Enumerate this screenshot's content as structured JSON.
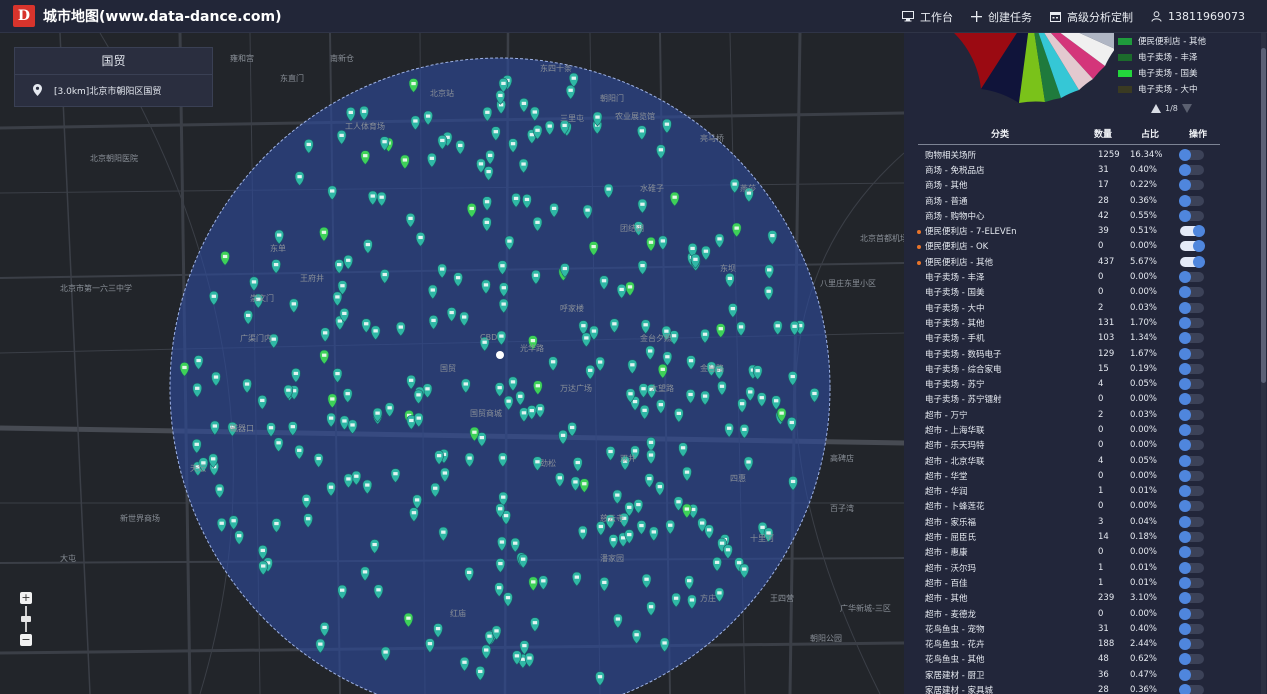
{
  "app": {
    "logo": "D",
    "title": "城市地图(www.data-dance.com)"
  },
  "header": {
    "actions": [
      {
        "icon": "desktop-icon",
        "label": "工作台"
      },
      {
        "icon": "plus-icon",
        "label": "创建任务"
      },
      {
        "icon": "calendar-icon",
        "label": "高级分析定制"
      },
      {
        "icon": "user-icon",
        "label": "13811969073"
      }
    ]
  },
  "district_panel": {
    "title": "国贸",
    "item": "[3.0km]北京市朝阳区国贸"
  },
  "map": {
    "labels": [
      "北京站",
      "朝阳门",
      "东四十条",
      "南新仓",
      "工人体育场",
      "三里屯",
      "农业展览馆",
      "亮马桥",
      "燕莎",
      "团结湖",
      "呼家楼",
      "金台夕照",
      "国贸",
      "大望路",
      "双井",
      "劲松",
      "潘家园",
      "广渠门内",
      "磁器口",
      "天坛",
      "崇文门",
      "东单",
      "王府井",
      "北京市第一六三中学",
      "东直门",
      "雍和宫",
      "和平里",
      "安贞",
      "北京朝阳医院",
      "国贸商城",
      "CBD",
      "光华路",
      "万达广场",
      "百子湾",
      "四惠",
      "高碑店",
      "十里河",
      "方庄",
      "朝阳公园",
      "八里庄东里小区",
      "广华新城-三区",
      "新世界商场",
      "北京首都机场",
      "大屯",
      "慈云寺",
      "东坝",
      "王四营",
      "红庙",
      "金台路",
      "水碓子"
    ]
  },
  "sidebar": {
    "legend": [
      {
        "label": "便民便利店 - 其他",
        "color": "#1f9b3c"
      },
      {
        "label": "电子卖场 - 丰泽",
        "color": "#1c6b2c"
      },
      {
        "label": "电子卖场 - 国美",
        "color": "#23d63c"
      },
      {
        "label": "电子卖场 - 大中",
        "color": "#3a3a22"
      }
    ],
    "pager": "1/8",
    "table": {
      "headers": [
        "分类",
        "数量",
        "占比",
        "操作"
      ],
      "rows": [
        {
          "category": "购物相关场所",
          "count": "1259",
          "percent": "16.34%",
          "on": false,
          "marked": false
        },
        {
          "category": "商场 - 免税品店",
          "count": "31",
          "percent": "0.40%",
          "on": false,
          "marked": false
        },
        {
          "category": "商场 - 其他",
          "count": "17",
          "percent": "0.22%",
          "on": false,
          "marked": false
        },
        {
          "category": "商场 - 普通",
          "count": "28",
          "percent": "0.36%",
          "on": false,
          "marked": false
        },
        {
          "category": "商场 - 购物中心",
          "count": "42",
          "percent": "0.55%",
          "on": false,
          "marked": false
        },
        {
          "category": "便民便利店 - 7-ELEVEn",
          "count": "39",
          "percent": "0.51%",
          "on": true,
          "marked": true
        },
        {
          "category": "便民便利店 - OK",
          "count": "0",
          "percent": "0.00%",
          "on": true,
          "marked": true
        },
        {
          "category": "便民便利店 - 其他",
          "count": "437",
          "percent": "5.67%",
          "on": true,
          "marked": true
        },
        {
          "category": "电子卖场 - 丰泽",
          "count": "0",
          "percent": "0.00%",
          "on": false,
          "marked": false
        },
        {
          "category": "电子卖场 - 国美",
          "count": "0",
          "percent": "0.00%",
          "on": false,
          "marked": false
        },
        {
          "category": "电子卖场 - 大中",
          "count": "2",
          "percent": "0.03%",
          "on": false,
          "marked": false
        },
        {
          "category": "电子卖场 - 其他",
          "count": "131",
          "percent": "1.70%",
          "on": false,
          "marked": false
        },
        {
          "category": "电子卖场 - 手机",
          "count": "103",
          "percent": "1.34%",
          "on": false,
          "marked": false
        },
        {
          "category": "电子卖场 - 数码电子",
          "count": "129",
          "percent": "1.67%",
          "on": false,
          "marked": false
        },
        {
          "category": "电子卖场 - 综合家电",
          "count": "15",
          "percent": "0.19%",
          "on": false,
          "marked": false
        },
        {
          "category": "电子卖场 - 苏宁",
          "count": "4",
          "percent": "0.05%",
          "on": false,
          "marked": false
        },
        {
          "category": "电子卖场 - 苏宁镭射",
          "count": "0",
          "percent": "0.00%",
          "on": false,
          "marked": false
        },
        {
          "category": "超市 - 万宁",
          "count": "2",
          "percent": "0.03%",
          "on": false,
          "marked": false
        },
        {
          "category": "超市 - 上海华联",
          "count": "0",
          "percent": "0.00%",
          "on": false,
          "marked": false
        },
        {
          "category": "超市 - 乐天玛特",
          "count": "0",
          "percent": "0.00%",
          "on": false,
          "marked": false
        },
        {
          "category": "超市 - 北京华联",
          "count": "4",
          "percent": "0.05%",
          "on": false,
          "marked": false
        },
        {
          "category": "超市 - 华堂",
          "count": "0",
          "percent": "0.00%",
          "on": false,
          "marked": false
        },
        {
          "category": "超市 - 华润",
          "count": "1",
          "percent": "0.01%",
          "on": false,
          "marked": false
        },
        {
          "category": "超市 - 卜蜂莲花",
          "count": "0",
          "percent": "0.00%",
          "on": false,
          "marked": false
        },
        {
          "category": "超市 - 家乐福",
          "count": "3",
          "percent": "0.04%",
          "on": false,
          "marked": false
        },
        {
          "category": "超市 - 屈臣氏",
          "count": "14",
          "percent": "0.18%",
          "on": false,
          "marked": false
        },
        {
          "category": "超市 - 惠康",
          "count": "0",
          "percent": "0.00%",
          "on": false,
          "marked": false
        },
        {
          "category": "超市 - 沃尔玛",
          "count": "1",
          "percent": "0.01%",
          "on": false,
          "marked": false
        },
        {
          "category": "超市 - 百佳",
          "count": "1",
          "percent": "0.01%",
          "on": false,
          "marked": false
        },
        {
          "category": "超市 - 其他",
          "count": "239",
          "percent": "3.10%",
          "on": false,
          "marked": false
        },
        {
          "category": "超市 - 麦德龙",
          "count": "0",
          "percent": "0.00%",
          "on": false,
          "marked": false
        },
        {
          "category": "花鸟鱼虫 - 宠物",
          "count": "31",
          "percent": "0.40%",
          "on": false,
          "marked": false
        },
        {
          "category": "花鸟鱼虫 - 花卉",
          "count": "188",
          "percent": "2.44%",
          "on": false,
          "marked": false
        },
        {
          "category": "花鸟鱼虫 - 其他",
          "count": "48",
          "percent": "0.62%",
          "on": false,
          "marked": false
        },
        {
          "category": "家居建材 - 厨卫",
          "count": "36",
          "percent": "0.47%",
          "on": false,
          "marked": false
        },
        {
          "category": "家居建材 - 家具城",
          "count": "28",
          "percent": "0.36%",
          "on": false,
          "marked": false
        }
      ]
    }
  }
}
